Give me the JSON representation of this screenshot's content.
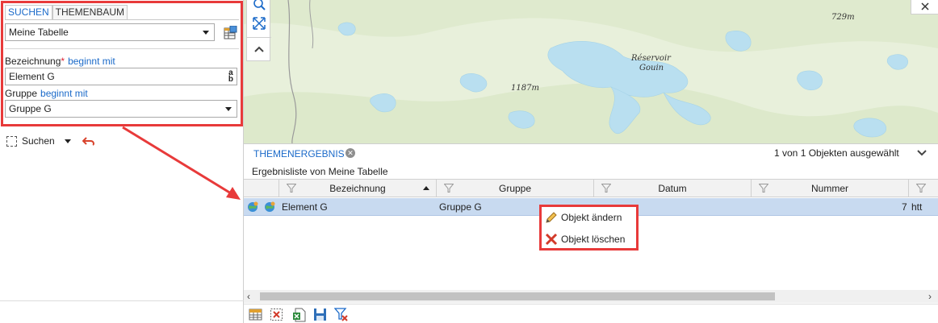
{
  "search_panel": {
    "tabs": [
      "SUCHEN",
      "THEMENBAUM"
    ],
    "table_select": "Meine Tabelle",
    "field1": {
      "label": "Bezeichnung",
      "required_mark": "*",
      "operator": "beginnt mit",
      "value": "Element G"
    },
    "field2": {
      "label": "Gruppe",
      "operator": "beginnt mit",
      "value": "Gruppe G"
    },
    "search_button": "Suchen"
  },
  "map": {
    "labels": {
      "elev1": "729m",
      "elev2": "1187m",
      "reservoir_line1": "Réservoir",
      "reservoir_line2": "Gouin"
    }
  },
  "results": {
    "tab_label": "THEMENERGEBNIS",
    "selection_status": "1 von 1 Objekten ausgewählt",
    "subtitle": "Ergebnisliste von Meine Tabelle",
    "columns": [
      "Bezeichnung",
      "Gruppe",
      "Datum",
      "Nummer"
    ],
    "rows": [
      {
        "bezeichnung": "Element G",
        "gruppe": "Gruppe G",
        "nummer": "7",
        "overflow": "htt"
      }
    ]
  },
  "context_menu": {
    "items": [
      "Objekt ändern",
      "Objekt löschen"
    ]
  },
  "colors": {
    "accent": "#1b6ac9",
    "highlight": "#e83a3a",
    "row_selected": "#c8daf0"
  },
  "icons": [
    "table-icon",
    "ab-clear-icon",
    "zoom-icon",
    "extent-icon",
    "chevron-up-icon",
    "close-icon",
    "chevron-down-icon",
    "funnel-icon",
    "globe-icon",
    "pencil-icon",
    "delete-x-icon",
    "excel-icon",
    "save-icon",
    "filter-clear-icon",
    "undo-icon"
  ]
}
